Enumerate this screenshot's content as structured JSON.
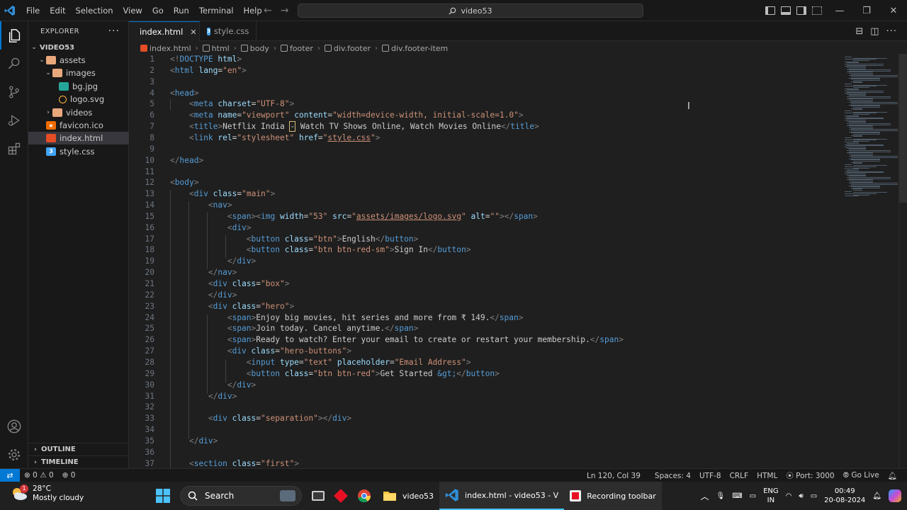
{
  "titlebar": {
    "menu": [
      "File",
      "Edit",
      "Selection",
      "View",
      "Go",
      "Run",
      "Terminal",
      "Help"
    ],
    "search": "video53"
  },
  "sidebar": {
    "title": "EXPLORER",
    "root": "VIDEO53",
    "tree": [
      {
        "label": "assets",
        "kind": "folder-open",
        "depth": 1
      },
      {
        "label": "images",
        "kind": "folder-open",
        "depth": 2
      },
      {
        "label": "bg.jpg",
        "kind": "image",
        "depth": 3
      },
      {
        "label": "logo.svg",
        "kind": "svg",
        "depth": 3
      },
      {
        "label": "videos",
        "kind": "folder",
        "depth": 2
      },
      {
        "label": "favicon.ico",
        "kind": "ico",
        "depth": 1
      },
      {
        "label": "index.html",
        "kind": "html",
        "depth": 1,
        "selected": true
      },
      {
        "label": "style.css",
        "kind": "css",
        "depth": 1
      }
    ],
    "outline": "OUTLINE",
    "timeline": "TIMELINE"
  },
  "tabs": [
    {
      "label": "index.html",
      "active": true
    },
    {
      "label": "style.css",
      "active": false
    }
  ],
  "breadcrumb": [
    "index.html",
    "html",
    "body",
    "footer",
    "div.footer",
    "div.footer-item"
  ],
  "code": {
    "lines": [
      [
        [
          "p",
          "<!"
        ],
        [
          "t",
          "DOCTYPE"
        ],
        [
          "x",
          " "
        ],
        [
          "a",
          "html"
        ],
        [
          "p",
          ">"
        ]
      ],
      [
        [
          "p",
          "<"
        ],
        [
          "t",
          "html"
        ],
        [
          "x",
          " "
        ],
        [
          "a",
          "lang"
        ],
        [
          "x",
          "="
        ],
        [
          "s",
          "\"en\""
        ],
        [
          "p",
          ">"
        ]
      ],
      [],
      [
        [
          "p",
          "<"
        ],
        [
          "t",
          "head"
        ],
        [
          "p",
          ">"
        ]
      ],
      [
        [
          "x",
          "    "
        ],
        [
          "p",
          "<"
        ],
        [
          "t",
          "meta"
        ],
        [
          "x",
          " "
        ],
        [
          "a",
          "charset"
        ],
        [
          "x",
          "="
        ],
        [
          "s",
          "\"UTF-8\""
        ],
        [
          "p",
          ">"
        ]
      ],
      [
        [
          "x",
          "    "
        ],
        [
          "p",
          "<"
        ],
        [
          "t",
          "meta"
        ],
        [
          "x",
          " "
        ],
        [
          "a",
          "name"
        ],
        [
          "x",
          "="
        ],
        [
          "s",
          "\"viewport\""
        ],
        [
          "x",
          " "
        ],
        [
          "a",
          "content"
        ],
        [
          "x",
          "="
        ],
        [
          "s",
          "\"width=device-width, initial-scale=1.0\""
        ],
        [
          "p",
          ">"
        ]
      ],
      [
        [
          "x",
          "    "
        ],
        [
          "p",
          "<"
        ],
        [
          "t",
          "title"
        ],
        [
          "p",
          ">"
        ],
        [
          "x",
          "Netflix India "
        ],
        [
          "w",
          "-"
        ],
        [
          "x",
          " Watch TV Shows Online, Watch Movies Online"
        ],
        [
          "p",
          "</"
        ],
        [
          "t",
          "title"
        ],
        [
          "p",
          ">"
        ]
      ],
      [
        [
          "x",
          "    "
        ],
        [
          "p",
          "<"
        ],
        [
          "t",
          "link"
        ],
        [
          "x",
          " "
        ],
        [
          "a",
          "rel"
        ],
        [
          "x",
          "="
        ],
        [
          "s",
          "\"stylesheet\""
        ],
        [
          "x",
          " "
        ],
        [
          "a",
          "href"
        ],
        [
          "x",
          "="
        ],
        [
          "s",
          "\""
        ],
        [
          "l",
          "style.css"
        ],
        [
          "s",
          "\""
        ],
        [
          "p",
          ">"
        ]
      ],
      [],
      [
        [
          "p",
          "</"
        ],
        [
          "t",
          "head"
        ],
        [
          "p",
          ">"
        ]
      ],
      [],
      [
        [
          "p",
          "<"
        ],
        [
          "t",
          "body"
        ],
        [
          "p",
          ">"
        ]
      ],
      [
        [
          "x",
          "    "
        ],
        [
          "p",
          "<"
        ],
        [
          "t",
          "div"
        ],
        [
          "x",
          " "
        ],
        [
          "a",
          "class"
        ],
        [
          "x",
          "="
        ],
        [
          "s",
          "\"main\""
        ],
        [
          "p",
          ">"
        ]
      ],
      [
        [
          "x",
          "        "
        ],
        [
          "p",
          "<"
        ],
        [
          "t",
          "nav"
        ],
        [
          "p",
          ">"
        ]
      ],
      [
        [
          "x",
          "            "
        ],
        [
          "p",
          "<"
        ],
        [
          "t",
          "span"
        ],
        [
          "p",
          "><"
        ],
        [
          "t",
          "img"
        ],
        [
          "x",
          " "
        ],
        [
          "a",
          "width"
        ],
        [
          "x",
          "="
        ],
        [
          "s",
          "\"53\""
        ],
        [
          "x",
          " "
        ],
        [
          "a",
          "src"
        ],
        [
          "x",
          "="
        ],
        [
          "s",
          "\""
        ],
        [
          "l",
          "assets/images/logo.svg"
        ],
        [
          "s",
          "\""
        ],
        [
          "x",
          " "
        ],
        [
          "a",
          "alt"
        ],
        [
          "x",
          "="
        ],
        [
          "s",
          "\"\""
        ],
        [
          "p",
          "></"
        ],
        [
          "t",
          "span"
        ],
        [
          "p",
          ">"
        ]
      ],
      [
        [
          "x",
          "            "
        ],
        [
          "p",
          "<"
        ],
        [
          "t",
          "div"
        ],
        [
          "p",
          ">"
        ]
      ],
      [
        [
          "x",
          "                "
        ],
        [
          "p",
          "<"
        ],
        [
          "t",
          "button"
        ],
        [
          "x",
          " "
        ],
        [
          "a",
          "class"
        ],
        [
          "x",
          "="
        ],
        [
          "s",
          "\"btn\""
        ],
        [
          "p",
          ">"
        ],
        [
          "x",
          "English"
        ],
        [
          "p",
          "</"
        ],
        [
          "t",
          "button"
        ],
        [
          "p",
          ">"
        ]
      ],
      [
        [
          "x",
          "                "
        ],
        [
          "p",
          "<"
        ],
        [
          "t",
          "button"
        ],
        [
          "x",
          " "
        ],
        [
          "a",
          "class"
        ],
        [
          "x",
          "="
        ],
        [
          "s",
          "\"btn btn-red-sm\""
        ],
        [
          "p",
          ">"
        ],
        [
          "x",
          "Sign In"
        ],
        [
          "p",
          "</"
        ],
        [
          "t",
          "button"
        ],
        [
          "p",
          ">"
        ]
      ],
      [
        [
          "x",
          "            "
        ],
        [
          "p",
          "</"
        ],
        [
          "t",
          "div"
        ],
        [
          "p",
          ">"
        ]
      ],
      [
        [
          "x",
          "        "
        ],
        [
          "p",
          "</"
        ],
        [
          "t",
          "nav"
        ],
        [
          "p",
          ">"
        ]
      ],
      [
        [
          "x",
          "        "
        ],
        [
          "p",
          "<"
        ],
        [
          "t",
          "div"
        ],
        [
          "x",
          " "
        ],
        [
          "a",
          "class"
        ],
        [
          "x",
          "="
        ],
        [
          "s",
          "\"box\""
        ],
        [
          "p",
          ">"
        ]
      ],
      [
        [
          "x",
          "        "
        ],
        [
          "p",
          "</"
        ],
        [
          "t",
          "div"
        ],
        [
          "p",
          ">"
        ]
      ],
      [
        [
          "x",
          "        "
        ],
        [
          "p",
          "<"
        ],
        [
          "t",
          "div"
        ],
        [
          "x",
          " "
        ],
        [
          "a",
          "class"
        ],
        [
          "x",
          "="
        ],
        [
          "s",
          "\"hero\""
        ],
        [
          "p",
          ">"
        ]
      ],
      [
        [
          "x",
          "            "
        ],
        [
          "p",
          "<"
        ],
        [
          "t",
          "span"
        ],
        [
          "p",
          ">"
        ],
        [
          "x",
          "Enjoy big movies, hit series and more from ₹ 149."
        ],
        [
          "p",
          "</"
        ],
        [
          "t",
          "span"
        ],
        [
          "p",
          ">"
        ]
      ],
      [
        [
          "x",
          "            "
        ],
        [
          "p",
          "<"
        ],
        [
          "t",
          "span"
        ],
        [
          "p",
          ">"
        ],
        [
          "x",
          "Join today. Cancel anytime."
        ],
        [
          "p",
          "</"
        ],
        [
          "t",
          "span"
        ],
        [
          "p",
          ">"
        ]
      ],
      [
        [
          "x",
          "            "
        ],
        [
          "p",
          "<"
        ],
        [
          "t",
          "span"
        ],
        [
          "p",
          ">"
        ],
        [
          "x",
          "Ready to watch? Enter your email to create or restart your membership."
        ],
        [
          "p",
          "</"
        ],
        [
          "t",
          "span"
        ],
        [
          "p",
          ">"
        ]
      ],
      [
        [
          "x",
          "            "
        ],
        [
          "p",
          "<"
        ],
        [
          "t",
          "div"
        ],
        [
          "x",
          " "
        ],
        [
          "a",
          "class"
        ],
        [
          "x",
          "="
        ],
        [
          "s",
          "\"hero-buttons\""
        ],
        [
          "p",
          ">"
        ]
      ],
      [
        [
          "x",
          "                "
        ],
        [
          "p",
          "<"
        ],
        [
          "t",
          "input"
        ],
        [
          "x",
          " "
        ],
        [
          "a",
          "type"
        ],
        [
          "x",
          "="
        ],
        [
          "s",
          "\"text\""
        ],
        [
          "x",
          " "
        ],
        [
          "a",
          "placeholder"
        ],
        [
          "x",
          "="
        ],
        [
          "s",
          "\"Email Address\""
        ],
        [
          "p",
          ">"
        ]
      ],
      [
        [
          "x",
          "                "
        ],
        [
          "p",
          "<"
        ],
        [
          "t",
          "button"
        ],
        [
          "x",
          " "
        ],
        [
          "a",
          "class"
        ],
        [
          "x",
          "="
        ],
        [
          "s",
          "\"btn btn-red\""
        ],
        [
          "p",
          ">"
        ],
        [
          "x",
          "Get Started "
        ],
        [
          "e",
          "&gt;"
        ],
        [
          "p",
          "</"
        ],
        [
          "t",
          "button"
        ],
        [
          "p",
          ">"
        ]
      ],
      [
        [
          "x",
          "            "
        ],
        [
          "p",
          "</"
        ],
        [
          "t",
          "div"
        ],
        [
          "p",
          ">"
        ]
      ],
      [
        [
          "x",
          "        "
        ],
        [
          "p",
          "</"
        ],
        [
          "t",
          "div"
        ],
        [
          "p",
          ">"
        ]
      ],
      [],
      [
        [
          "x",
          "        "
        ],
        [
          "p",
          "<"
        ],
        [
          "t",
          "div"
        ],
        [
          "x",
          " "
        ],
        [
          "a",
          "class"
        ],
        [
          "x",
          "="
        ],
        [
          "s",
          "\"separation\""
        ],
        [
          "p",
          "></"
        ],
        [
          "t",
          "div"
        ],
        [
          "p",
          ">"
        ]
      ],
      [],
      [
        [
          "x",
          "    "
        ],
        [
          "p",
          "</"
        ],
        [
          "t",
          "div"
        ],
        [
          "p",
          ">"
        ]
      ],
      [],
      [
        [
          "x",
          "    "
        ],
        [
          "p",
          "<"
        ],
        [
          "t",
          "section"
        ],
        [
          "x",
          " "
        ],
        [
          "a",
          "class"
        ],
        [
          "x",
          "="
        ],
        [
          "s",
          "\"first\""
        ],
        [
          "p",
          ">"
        ]
      ]
    ]
  },
  "status": {
    "errors": "0",
    "warnings": "0",
    "ports": "0",
    "position": "Ln 120, Col 39",
    "spaces": "Spaces: 4",
    "encoding": "UTF-8",
    "eol": "CRLF",
    "language": "HTML",
    "port": "Port: 3000",
    "golive": "Go Live"
  },
  "taskbar": {
    "weather_temp": "28°C",
    "weather_desc": "Mostly cloudy",
    "weather_badge": "1",
    "search": "Search",
    "apps": [
      {
        "label": "video53",
        "icon": "folder-icon"
      },
      {
        "label": "index.html - video53 - V",
        "icon": "vscode-icon"
      },
      {
        "label": "Recording toolbar",
        "icon": "recording-icon"
      }
    ],
    "lang_top": "ENG",
    "lang_bottom": "IN",
    "time": "00:49",
    "date": "20-08-2024"
  },
  "colors": {
    "accent": "#0078d4",
    "tag": "#569cd6",
    "attribute": "#9cdcfe",
    "string": "#ce9178",
    "punctuation": "#808080"
  }
}
